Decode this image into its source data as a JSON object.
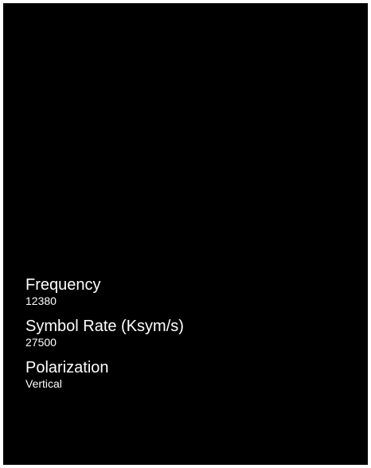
{
  "settings": {
    "items": [
      {
        "label": "Frequency",
        "value": "12380"
      },
      {
        "label": "Symbol Rate (Ksym/s)",
        "value": "27500"
      },
      {
        "label": "Polarization",
        "value": "Vertical"
      }
    ]
  },
  "colors": {
    "background": "#000000",
    "text": "#ffffff"
  }
}
